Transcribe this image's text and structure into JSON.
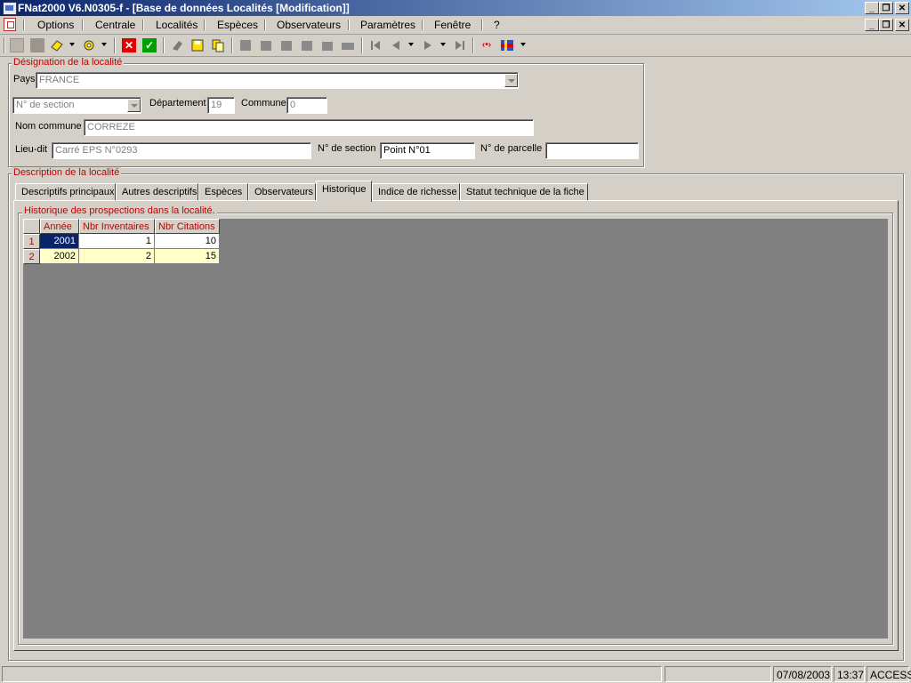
{
  "window": {
    "title": "FNat2000 V6.N0305-f - [Base de données Localités [Modification]]",
    "controls": [
      "_",
      "❐",
      "✕"
    ]
  },
  "menu": {
    "items": [
      "Options",
      "Centrale",
      "Localités",
      "Espèces",
      "Observateurs",
      "Paramètres",
      "Fenêtre",
      "?"
    ]
  },
  "toolbar": {
    "icons": [
      "new-icon",
      "blank-icon",
      "erase-icon",
      "search-icon",
      "cancel-icon",
      "validate-icon",
      "eraser-icon",
      "save-icon",
      "copy-icon",
      "first-record-icon",
      "prev-record-icon",
      "next-record-icon",
      "last-record-icon"
    ],
    "accent_red": "#e00000",
    "accent_green": "#00a000"
  },
  "designation": {
    "legend": "Désignation de la localité",
    "pays_label": "Pays",
    "pays_value": "FRANCE",
    "section_select": "N° de section",
    "departement_label": "Département",
    "departement_value": "19",
    "commune_label": "Commune",
    "commune_value": "0",
    "nom_commune_label": "Nom commune",
    "nom_commune_value": "CORREZE",
    "lieudit_label": "Lieu-dit",
    "lieudit_value": "Carré EPS N°0293",
    "nsection_label": "N° de section",
    "nsection_value": "Point N°01",
    "nparcelle_label": "N° de parcelle",
    "nparcelle_value": ""
  },
  "description": {
    "legend": "Description de la localité",
    "tabs": [
      "Descriptifs principaux",
      "Autres descriptifs",
      "Espèces",
      "Observateurs",
      "Historique",
      "Indice de richesse",
      "Statut technique de la fiche"
    ],
    "active_tab": "Historique"
  },
  "historique": {
    "legend": "Historique des prospections dans la localité.",
    "columns": [
      "Année",
      "Nbr Inventaires",
      "Nbr Citations"
    ],
    "rows": [
      {
        "index": "1",
        "annee": "2001",
        "inventaires": "1",
        "citations": "10"
      },
      {
        "index": "2",
        "annee": "2002",
        "inventaires": "2",
        "citations": "15"
      }
    ]
  },
  "status": {
    "date": "07/08/2003",
    "time": "13:37",
    "mode": "ACCESS"
  }
}
